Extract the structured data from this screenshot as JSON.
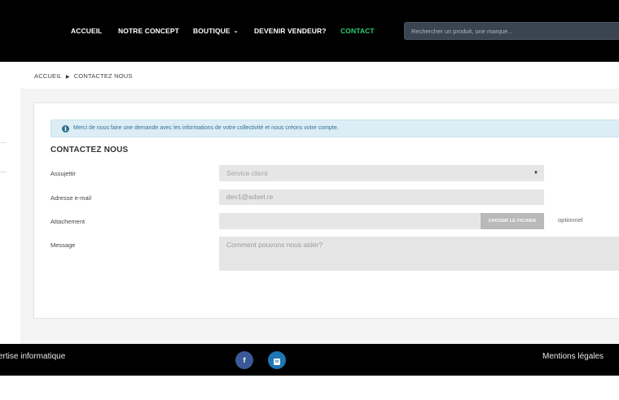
{
  "nav": {
    "items": [
      {
        "label": "ACCUEIL"
      },
      {
        "label": "NOTRE CONCEPT"
      },
      {
        "label": "BOUTIQUE"
      },
      {
        "label": "DEVENIR VENDEUR?"
      },
      {
        "label": "CONTACT",
        "active": true
      }
    ],
    "active_color": "#2ecc71"
  },
  "search": {
    "placeholder": "Rechercher un produit, une marque..."
  },
  "breadcrumb": {
    "home": "ACCUEIL",
    "current": "CONTACTEZ NOUS"
  },
  "alert": {
    "text": "Merci de nous faire une demande avec les informations de votre collectivité et nous créons votre compte.",
    "icon": "info-icon"
  },
  "form": {
    "title": "CONTACTEZ NOUS",
    "subject_label": "Assujettir",
    "subject_value": "Service client",
    "email_label": "Adresse e-mail",
    "email_value": "dev1@adsel.re",
    "attachment_label": "Attachement",
    "file_button": "CHOISIR LE FICHIER",
    "optional": "optionnel",
    "message_label": "Message",
    "message_placeholder": "Comment pouvons nous aider?"
  },
  "footer": {
    "left_text": "ertise informatique",
    "right_text": "Mentions légales",
    "facebook": "f",
    "linkedin": "in"
  }
}
